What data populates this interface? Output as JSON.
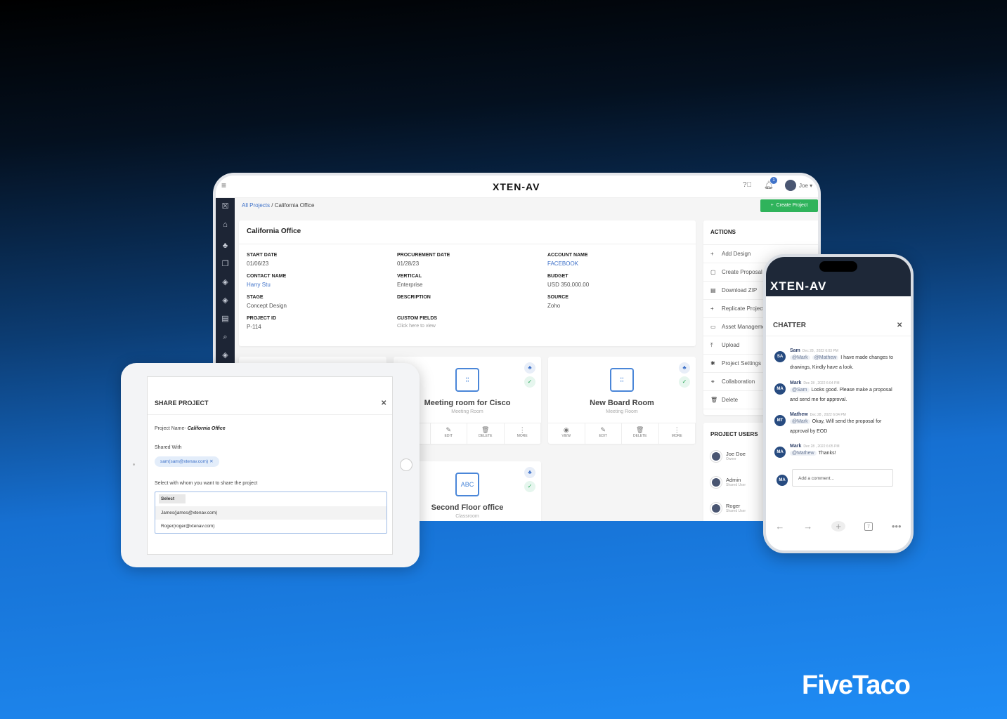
{
  "laptop": {
    "logo": "XTEN-AV",
    "user": "Joe",
    "notif_count": "1",
    "breadcrumb": {
      "root": "All Projects",
      "sep": "/",
      "current": "California Office"
    },
    "create_button": "Create Project",
    "project": {
      "title": "California Office",
      "fields": [
        {
          "label": "START DATE",
          "value": "01/06/23"
        },
        {
          "label": "PROCUREMENT DATE",
          "value": "01/28/23"
        },
        {
          "label": "ACCOUNT NAME",
          "value": "FACEBOOK",
          "link": true
        },
        {
          "label": "CONTACT NAME",
          "value": "Harry Stu",
          "link": true
        },
        {
          "label": "VERTICAL",
          "value": "Enterprise"
        },
        {
          "label": "BUDGET",
          "value": "USD 350,000.00"
        },
        {
          "label": "STAGE",
          "value": "Concept Design"
        },
        {
          "label": "DESCRIPTION",
          "value": ""
        },
        {
          "label": "SOURCE",
          "value": "Zoho"
        },
        {
          "label": "PROJECT ID",
          "value": "P-114"
        },
        {
          "label": "CUSTOM FIELDS",
          "value": "Click here to view",
          "muted": true
        }
      ]
    },
    "actions": {
      "title": "ACTIONS",
      "items": [
        {
          "icon": "+",
          "label": "Add Design"
        },
        {
          "icon": "▢",
          "label": "Create Proposal"
        },
        {
          "icon": "▤",
          "label": "Download ZIP"
        },
        {
          "icon": "+",
          "label": "Replicate Project"
        },
        {
          "icon": "▭",
          "label": "Asset Management"
        },
        {
          "icon": "⤒",
          "label": "Upload"
        },
        {
          "icon": "✱",
          "label": "Project Settings"
        },
        {
          "icon": "⚭",
          "label": "Collaboration"
        },
        {
          "icon": "🗑",
          "label": "Delete"
        }
      ]
    },
    "users": {
      "title": "PROJECT USERS",
      "items": [
        {
          "name": "Joe Doe",
          "role": "Owner"
        },
        {
          "name": "Admin",
          "role": "Shared User"
        },
        {
          "name": "Roger",
          "role": "Shared User"
        }
      ]
    },
    "rooms": [
      {
        "title": "Meeting room for Cisco",
        "type": "Meeting Room"
      },
      {
        "title": "New Board Room",
        "type": "Meeting Room"
      },
      {
        "title": "Second Floor office",
        "type": "Classroom"
      }
    ],
    "room_buttons": {
      "view": "VIEW",
      "edit": "EDIT",
      "delete": "DELETE",
      "more": "MORE"
    }
  },
  "share": {
    "title": "SHARE PROJECT",
    "project_label": "Project Name-",
    "project_name": "California Office",
    "shared_with_label": "Shared With",
    "chip": "sam(sam@xtenav.com)",
    "select_label": "Select with whom you want to share the project",
    "select_placeholder": "Select",
    "options": [
      "James(james@xtenav.com)",
      "Roger(roger@xtenav.com)"
    ]
  },
  "phone": {
    "logo": "XTEN-AV",
    "chatter_title": "CHATTER",
    "messages": [
      {
        "initials": "SA",
        "name": "Sam",
        "time": "Dec 28 , 2022 6:03 PM",
        "tags": [
          "@Mark",
          "@Mathew"
        ],
        "text": "I have made changes to drawings, Kindly have a look."
      },
      {
        "initials": "MA",
        "name": "Mark",
        "time": "Dec 28 , 2022 6:04 PM",
        "tags": [
          "@Sam"
        ],
        "text": "Looks good. Please make a proposal and send me for approval."
      },
      {
        "initials": "MT",
        "name": "Mathew",
        "time": "Dec 28 , 2022 6:04 PM",
        "tags": [
          "@Mark"
        ],
        "text": "Okay, Will send the proposal for approval by EOD"
      },
      {
        "initials": "MA",
        "name": "Mark",
        "time": "Dec 28 , 2022 6:05 PM",
        "tags": [
          "@Mathew"
        ],
        "text": "Thanks!"
      }
    ],
    "comment_initials": "MA",
    "comment_placeholder": "Add a comment...",
    "tab_count": "7"
  },
  "brand": "FiveTaco",
  "colors": {
    "accent": "#3f72c9",
    "green": "#2fb35b",
    "sidebar": "#1d2535",
    "phone_header": "#1e2838"
  }
}
